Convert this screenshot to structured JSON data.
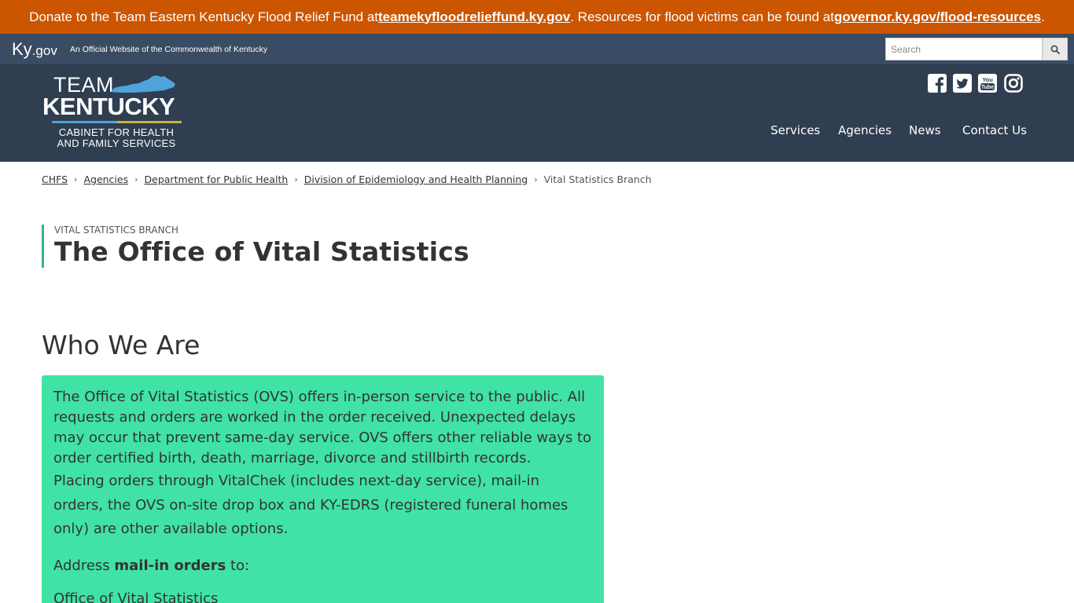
{
  "alert": {
    "text1": "Donate to the Team Eastern Kentucky Flood Relief Fund at ",
    "link1": "teamekyfloodrelieffund.ky.gov",
    "text2": ". Resources for flood victims can be found at ",
    "link2": "governor.ky.gov/flood-resources",
    "text3": "."
  },
  "kygov": {
    "ky": "Ky",
    "gov": ".gov",
    "tagline": "An Official Website of the Commonwealth of Kentucky",
    "search_placeholder": "Search"
  },
  "logo": {
    "team": "TEAM",
    "kentucky": "KENTUCKY",
    "cabinet_line1": "CABINET FOR HEALTH",
    "cabinet_line2": "AND FAMILY SERVICES"
  },
  "social": [
    "facebook-icon",
    "twitter-icon",
    "youtube-icon",
    "instagram-icon"
  ],
  "nav": {
    "services": "Services",
    "agencies": "Agencies",
    "news": "News",
    "contact": "Contact Us"
  },
  "breadcrumb": {
    "items": [
      "CHFS",
      "Agencies",
      "Department for Public Health",
      "Division of Epidemiology and Health Planning"
    ],
    "current": "Vital Statistics Branch"
  },
  "page": {
    "eyebrow": "Vital Statistics Branch",
    "title": "The Office of Vital Statistics",
    "section_title": "Who We Are"
  },
  "info": {
    "p1": "The Office of Vital Statistics (OVS) offers in-person service to the public. All requests and orders are worked in the order received. Unexpected delays may occur that prevent same-day service. OVS offers other reliable ways to order certified birth, death, marriage, divorce and stillbirth records.",
    "p2": "Placing orders through VitalChek (includes next-day service), mail-in orders, the OVS on-site drop box and KY-EDRS (registered funeral homes only) are other available options.",
    "p3_before": "Address ",
    "p3_bold": "mail-in orders",
    "p3_after": " to:",
    "p4": "Office of Vital Statistics"
  },
  "colors": {
    "alert_bg": "#cc5500",
    "kygov_bg": "#3a4c63",
    "header_bg": "#2f3e50",
    "accent_green": "#3cb38b",
    "info_bg": "#40e3a5",
    "ky_blue": "#4fa3dd",
    "ky_gold": "#c8b340"
  }
}
